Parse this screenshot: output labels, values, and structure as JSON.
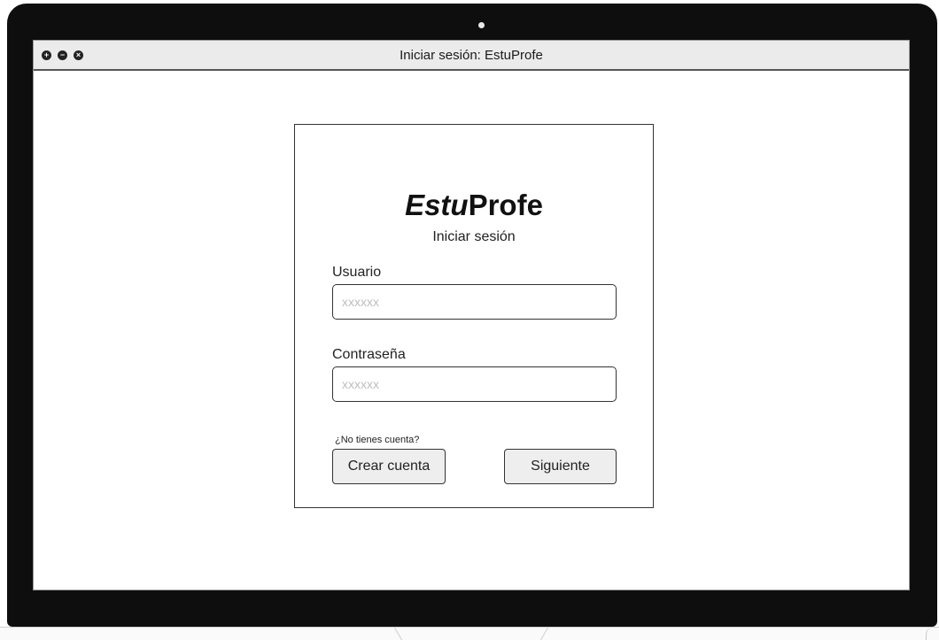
{
  "window": {
    "title": "Iniciar sesión: EstuProfe",
    "controls": [
      {
        "name": "maximize",
        "glyph": "+"
      },
      {
        "name": "minimize",
        "glyph": "−"
      },
      {
        "name": "close",
        "glyph": "×"
      }
    ]
  },
  "login": {
    "brand_italic": "Estu",
    "brand_bold": "Profe",
    "subtitle": "Iniciar sesión",
    "username": {
      "label": "Usuario",
      "placeholder": "xxxxxx",
      "value": ""
    },
    "password": {
      "label": "Contraseña",
      "placeholder": "xxxxxx",
      "value": ""
    },
    "no_account_text": "¿No tienes cuenta?",
    "create_account_label": "Crear cuenta",
    "next_label": "Siguiente"
  },
  "colors": {
    "frame": "#0e0e0e",
    "titlebar": "#ebebeb",
    "button_bg": "#eeeeee",
    "placeholder": "#bdbdbd"
  }
}
